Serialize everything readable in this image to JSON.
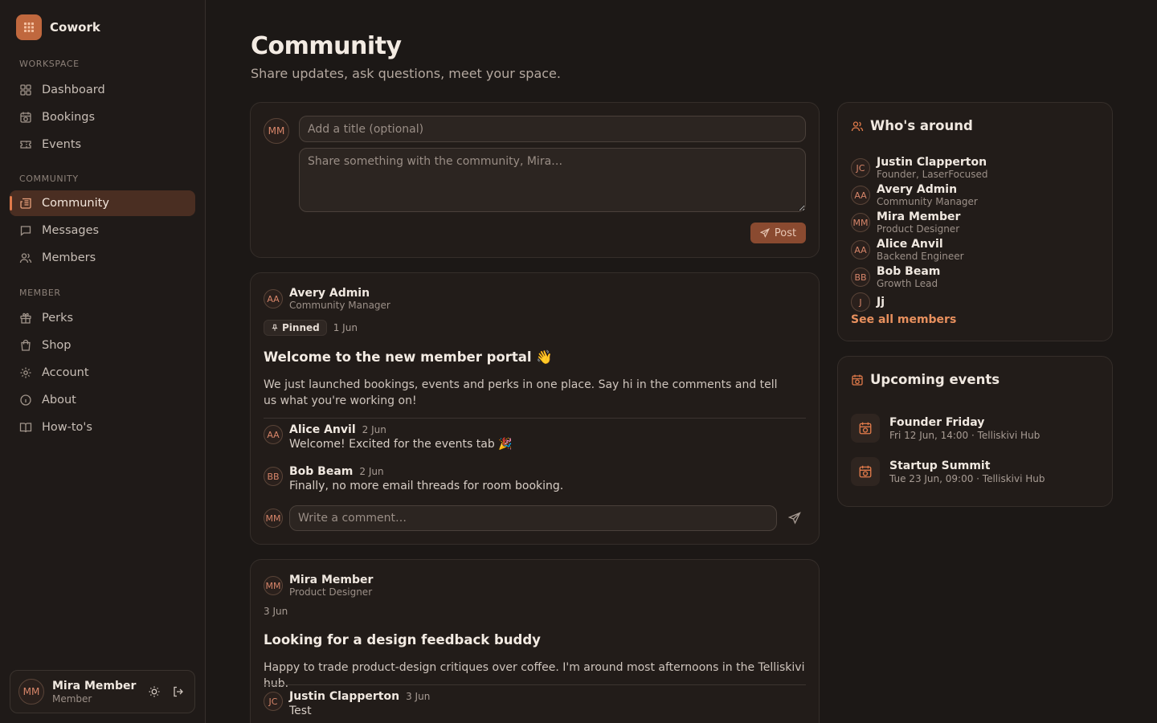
{
  "brand": {
    "name": "Cowork"
  },
  "nav": {
    "workspace_heading": "WORKSPACE",
    "workspace_items": [
      {
        "label": "Dashboard",
        "icon": "grid-icon"
      },
      {
        "label": "Bookings",
        "icon": "calendar-clock-icon"
      },
      {
        "label": "Events",
        "icon": "ticket-icon"
      }
    ],
    "community_heading": "COMMUNITY",
    "community_items": [
      {
        "label": "Community",
        "icon": "newspaper-icon",
        "active": true
      },
      {
        "label": "Messages",
        "icon": "message-square-icon"
      },
      {
        "label": "Members",
        "icon": "users-icon"
      }
    ],
    "member_heading": "MEMBER",
    "member_items": [
      {
        "label": "Perks",
        "icon": "gift-icon"
      },
      {
        "label": "Shop",
        "icon": "shopping-bag-icon"
      },
      {
        "label": "Account",
        "icon": "gear-icon"
      },
      {
        "label": "About",
        "icon": "info-icon"
      },
      {
        "label": "How-to's",
        "icon": "book-icon"
      }
    ]
  },
  "current_user": {
    "initials": "MM",
    "name": "Mira Member",
    "role": "Member"
  },
  "page": {
    "title": "Community",
    "subtitle": "Share updates, ask questions, meet your space."
  },
  "composer": {
    "avatar": "MM",
    "title_placeholder": "Add a title (optional)",
    "body_placeholder": "Share something with the community, Mira…",
    "post_label": "Post"
  },
  "posts": [
    {
      "author_initials": "AA",
      "author": "Avery Admin",
      "role": "Community Manager",
      "pinned_label": "Pinned",
      "date": "1 Jun",
      "title": "Welcome to the new member portal 👋",
      "body": "We just launched bookings, events and perks in one place. Say hi in the comments and tell us what you're working on!",
      "comments": [
        {
          "initials": "AA",
          "name": "Alice Anvil",
          "date": "2 Jun",
          "text": "Welcome! Excited for the events tab 🎉"
        },
        {
          "initials": "BB",
          "name": "Bob Beam",
          "date": "2 Jun",
          "text": "Finally, no more email threads for room booking."
        }
      ],
      "comment_avatar": "MM",
      "comment_placeholder": "Write a comment…"
    },
    {
      "author_initials": "MM",
      "author": "Mira Member",
      "role": "Product Designer",
      "date": "3 Jun",
      "title": "Looking for a design feedback buddy",
      "body": "Happy to trade product-design critiques over coffee. I'm around most afternoons in the Telliskivi hub.",
      "comments": [
        {
          "initials": "JC",
          "name": "Justin Clapperton",
          "date": "3 Jun",
          "text": "Test"
        }
      ]
    }
  ],
  "whos_around": {
    "title": "Who's around",
    "members": [
      {
        "initials": "JC",
        "name": "Justin Clapperton",
        "role": "Founder, LaserFocused"
      },
      {
        "initials": "AA",
        "name": "Avery Admin",
        "role": "Community Manager"
      },
      {
        "initials": "MM",
        "name": "Mira Member",
        "role": "Product Designer"
      },
      {
        "initials": "AA",
        "name": "Alice Anvil",
        "role": "Backend Engineer"
      },
      {
        "initials": "BB",
        "name": "Bob Beam",
        "role": "Growth Lead"
      },
      {
        "initials": "J",
        "name": "Jj",
        "role": ""
      }
    ],
    "see_all": "See all members"
  },
  "upcoming_events": {
    "title": "Upcoming events",
    "events": [
      {
        "name": "Founder Friday",
        "meta": "Fri 12 Jun, 14:00 · Telliskivi Hub"
      },
      {
        "name": "Startup Summit",
        "meta": "Tue 23 Jun, 09:00 · Telliskivi Hub"
      }
    ]
  },
  "colors": {
    "accent": "#e07a4a",
    "background": "#1c1816",
    "card": "#221c19",
    "active_nav": "#4a2e22"
  }
}
